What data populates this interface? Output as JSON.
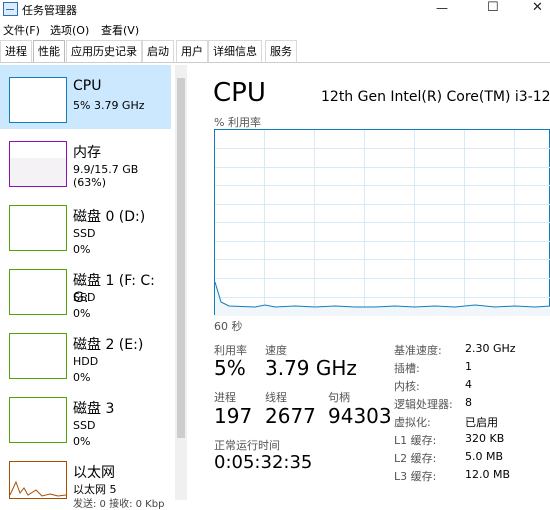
{
  "window": {
    "title": "任务管理器"
  },
  "menu": [
    "文件(F)",
    "选项(O)",
    "查看(V)"
  ],
  "tabs": [
    "进程",
    "性能",
    "应用历史记录",
    "启动",
    "用户",
    "详细信息",
    "服务"
  ],
  "sidebar": {
    "cpu": {
      "name": "CPU",
      "line1": "5% 3.79 GHz"
    },
    "memory": {
      "name": "内存",
      "line1": "9.9/15.7 GB (63%)"
    },
    "disk0": {
      "name": "磁盘 0 (D:)",
      "line1": "SSD",
      "line2": "0%"
    },
    "disk1": {
      "name": "磁盘 1 (F: C: G:",
      "line1": "SSD",
      "line2": "0%"
    },
    "disk2": {
      "name": "磁盘 2 (E:)",
      "line1": "HDD",
      "line2": "0%"
    },
    "disk3": {
      "name": "磁盘 3",
      "line1": "SSD",
      "line2": "0%"
    },
    "ethernet": {
      "name": "以太网",
      "line1": "以太网 5",
      "line2": "发送: 0 接收: 0 Kbp"
    }
  },
  "main": {
    "title": "CPU",
    "processor": "12th Gen Intel(R) Core(TM) i3-12",
    "graph_label": "% 利用率",
    "time_label": "60 秒",
    "utilization_label": "利用率",
    "utilization": "5%",
    "speed_label": "速度",
    "speed": "3.79 GHz",
    "processes_label": "进程",
    "processes": "197",
    "threads_label": "线程",
    "threads": "2677",
    "handles_label": "句柄",
    "handles": "94303",
    "uptime_label": "正常运行时间",
    "uptime": "0:05:32:35",
    "specs": [
      {
        "k": "基准速度:",
        "v": "2.30 GHz"
      },
      {
        "k": "插槽:",
        "v": "1"
      },
      {
        "k": "内核:",
        "v": "4"
      },
      {
        "k": "逻辑处理器:",
        "v": "8"
      },
      {
        "k": "虚拟化:",
        "v": "已启用"
      },
      {
        "k": "L1 缓存:",
        "v": "320 KB"
      },
      {
        "k": "L2 缓存:",
        "v": "5.0 MB"
      },
      {
        "k": "L3 缓存:",
        "v": "12.0 MB"
      }
    ]
  },
  "colors": {
    "cpu": "#117dbb",
    "memory": "#8b12ae",
    "disk": "#4da60c",
    "ethernet": "#a74f01",
    "selected": "#cce8ff"
  }
}
